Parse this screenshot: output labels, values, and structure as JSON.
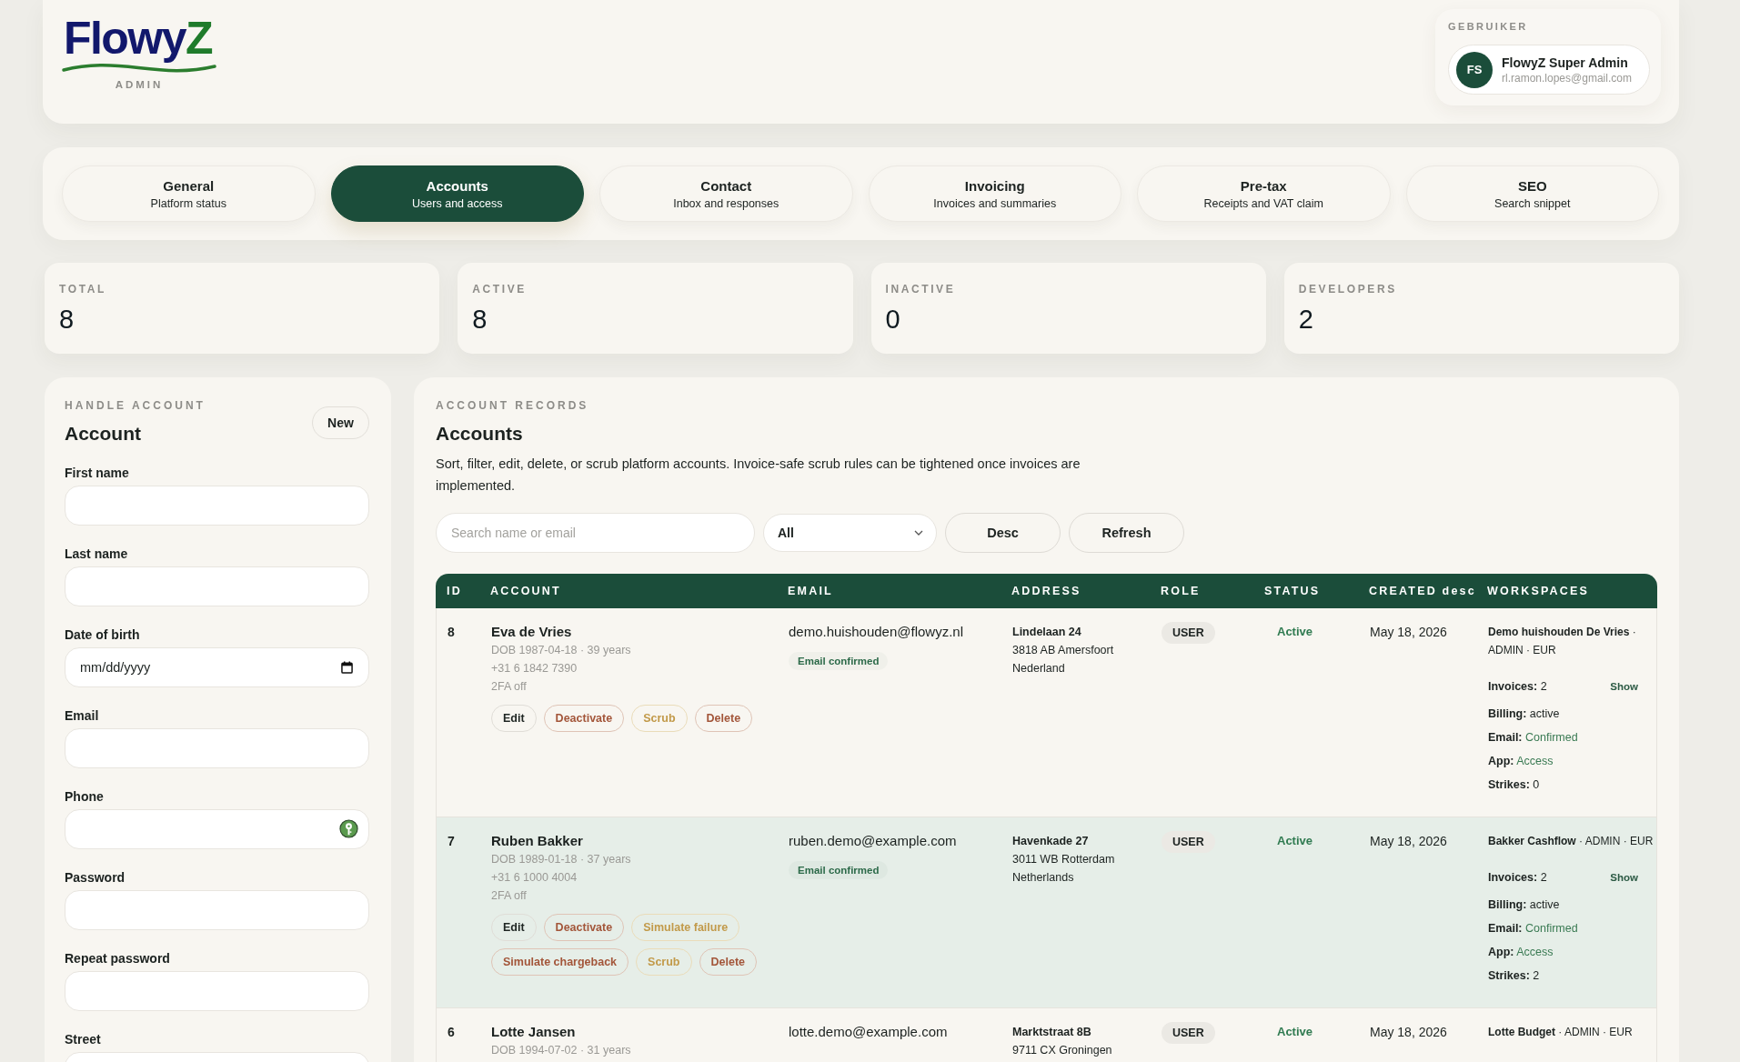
{
  "header": {
    "logo": "FlowyZ",
    "logo_subtitle": "ADMIN",
    "user": {
      "label": "GEBRUIKER",
      "initials": "FS",
      "name": "FlowyZ Super Admin",
      "email": "rl.ramon.lopes@gmail.com"
    }
  },
  "tabs": [
    {
      "title": "General",
      "subtitle": "Platform status",
      "selected": false
    },
    {
      "title": "Accounts",
      "subtitle": "Users and access",
      "selected": true
    },
    {
      "title": "Contact",
      "subtitle": "Inbox and responses",
      "selected": false
    },
    {
      "title": "Invoicing",
      "subtitle": "Invoices and summaries",
      "selected": false
    },
    {
      "title": "Pre-tax",
      "subtitle": "Receipts and VAT claim",
      "selected": false
    },
    {
      "title": "SEO",
      "subtitle": "Search snippet",
      "selected": false
    }
  ],
  "stats": [
    {
      "label": "TOTAL",
      "value": "8"
    },
    {
      "label": "ACTIVE",
      "value": "8"
    },
    {
      "label": "INACTIVE",
      "value": "0"
    },
    {
      "label": "DEVELOPERS",
      "value": "2"
    }
  ],
  "account_form": {
    "eyebrow": "HANDLE ACCOUNT",
    "title": "Account",
    "new_button": "New",
    "fields": [
      {
        "label": "First name",
        "kind": "text",
        "autofill_icon": false
      },
      {
        "label": "Last name",
        "kind": "text",
        "autofill_icon": false
      },
      {
        "label": "Date of birth",
        "kind": "date",
        "placeholder": "mm/dd/yyyy",
        "autofill_icon": false
      },
      {
        "label": "Email",
        "kind": "text",
        "autofill_icon": false
      },
      {
        "label": "Phone",
        "kind": "text",
        "autofill_icon": true
      },
      {
        "label": "Password",
        "kind": "text",
        "autofill_icon": false
      },
      {
        "label": "Repeat password",
        "kind": "text",
        "autofill_icon": false
      },
      {
        "label": "Street",
        "kind": "text",
        "autofill_icon": false
      }
    ]
  },
  "account_records": {
    "eyebrow": "ACCOUNT RECORDS",
    "title": "Accounts",
    "description": "Sort, filter, edit, delete, or scrub platform accounts. Invoice-safe scrub rules can be tightened once invoices are implemented.",
    "search": {
      "placeholder": "Search name or email"
    },
    "filter": {
      "value": "All"
    },
    "buttons": [
      "Desc",
      "Refresh"
    ],
    "table": {
      "columns": [
        "ID",
        "ACCOUNT",
        "EMAIL",
        "ADDRESS",
        "ROLE",
        "STATUS",
        "CREATED desc",
        "WORKSPACES"
      ],
      "rows": [
        {
          "id": "8",
          "name": "Eva de Vries",
          "details": [
            "DOB 1987-04-18 · 39 years",
            "+31 6 1842 7390",
            "2FA off"
          ],
          "actions": [
            {
              "label": "Edit",
              "kind": "neutral"
            },
            {
              "label": "Deactivate",
              "kind": "danger"
            },
            {
              "label": "Scrub",
              "kind": "warning"
            },
            {
              "label": "Delete",
              "kind": "danger"
            }
          ],
          "email": "demo.huishouden@flowyz.nl",
          "email_badge": "Email confirmed",
          "address_street": "Lindelaan 24",
          "address_lines": [
            "3818 AB Amersfoort",
            "Nederland"
          ],
          "role": "USER",
          "status": "Active",
          "created": "May 18, 2026",
          "workspace": "**Demo huishouden De Vries** · ADMIN · EUR",
          "workspace_details": [
            {
              "label": "Invoices:",
              "value": "2",
              "kind": "plain",
              "link": "Show"
            },
            {
              "label": "Billing:",
              "value": "active",
              "kind": "plain"
            },
            {
              "label": "Email:",
              "value": "Confirmed",
              "kind": "ok"
            },
            {
              "label": "App:",
              "value": "Access",
              "kind": "ok"
            },
            {
              "label": "Strikes:",
              "value": "0",
              "kind": "plain"
            }
          ],
          "highlighted": false
        },
        {
          "id": "7",
          "name": "Ruben Bakker",
          "details": [
            "DOB 1989-01-18 · 37 years",
            "+31 6 1000 4004",
            "2FA off"
          ],
          "actions": [
            {
              "label": "Edit",
              "kind": "neutral"
            },
            {
              "label": "Deactivate",
              "kind": "danger"
            },
            {
              "label": "Simulate failure",
              "kind": "warning"
            },
            {
              "label": "Simulate chargeback",
              "kind": "danger"
            },
            {
              "label": "Scrub",
              "kind": "warning"
            },
            {
              "label": "Delete",
              "kind": "danger"
            }
          ],
          "email": "ruben.demo@example.com",
          "email_badge": "Email confirmed",
          "address_street": "Havenkade 27",
          "address_lines": [
            "3011 WB Rotterdam",
            "Netherlands"
          ],
          "role": "USER",
          "status": "Active",
          "created": "May 18, 2026",
          "workspace": "**Bakker Cashflow** · ADMIN · EUR",
          "workspace_details": [
            {
              "label": "Invoices:",
              "value": "2",
              "kind": "plain",
              "link": "Show"
            },
            {
              "label": "Billing:",
              "value": "active",
              "kind": "plain"
            },
            {
              "label": "Email:",
              "value": "Confirmed",
              "kind": "ok"
            },
            {
              "label": "App:",
              "value": "Access",
              "kind": "ok"
            },
            {
              "label": "Strikes:",
              "value": "2",
              "kind": "plain"
            }
          ],
          "highlighted": true
        },
        {
          "id": "6",
          "name": "Lotte Jansen",
          "details": [
            "DOB 1994-07-02 · 31 years"
          ],
          "email": "lotte.demo@example.com",
          "address_street": "Marktstraat 8B",
          "address_lines": [
            "9711 CX Groningen"
          ],
          "role": "USER",
          "status": "Active",
          "created": "May 18, 2026",
          "workspace": "**Lotte Budget** · ADMIN · EUR",
          "highlighted": false
        }
      ]
    }
  }
}
